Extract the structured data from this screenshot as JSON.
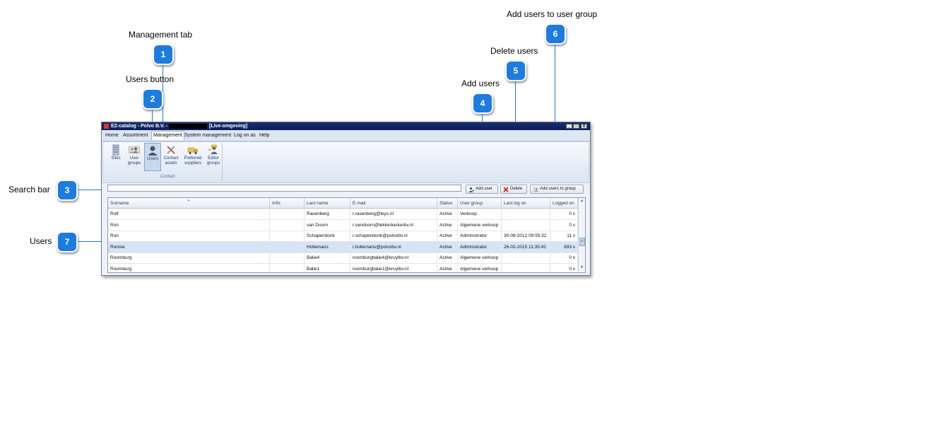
{
  "callouts": [
    {
      "num": "1",
      "label": "Management tab"
    },
    {
      "num": "2",
      "label": "Users button"
    },
    {
      "num": "3",
      "label": "Search bar"
    },
    {
      "num": "4",
      "label": "Add users"
    },
    {
      "num": "5",
      "label": "Delete users"
    },
    {
      "num": "6",
      "label": "Add users to user group"
    },
    {
      "num": "7",
      "label": "Users"
    }
  ],
  "window": {
    "title": "EZ-catalog - Polvo B.V. -",
    "environment": "[Live-omgeving]",
    "controls": {
      "minimize": "_",
      "maximize": "□",
      "close": "X"
    }
  },
  "menu": [
    "Home",
    "Assortment",
    "Management",
    "System management",
    "Log on as",
    "Help"
  ],
  "active_menu": "Management",
  "ribbon": {
    "buttons": [
      {
        "label1": "Sites",
        "label2": "",
        "icon": "building-icon"
      },
      {
        "label1": "User",
        "label2": "groups",
        "icon": "user-group-icon"
      },
      {
        "label1": "Users",
        "label2": "",
        "icon": "user-icon",
        "selected": true
      },
      {
        "label1": "Contact",
        "label2": "assets",
        "icon": "tools-icon"
      },
      {
        "label1": "Preferred",
        "label2": "suppliers",
        "icon": "truck-icon"
      },
      {
        "label1": "Editor",
        "label2": "groups",
        "icon": "editor-group-icon"
      }
    ],
    "group_label": "Contact"
  },
  "search": {
    "value": "",
    "placeholder": ""
  },
  "toolbar": {
    "add_user": "Add user",
    "delete": "Delete",
    "add_to_group": "Add users to group"
  },
  "grid": {
    "columns": [
      "Surname",
      "Infix",
      "Last name",
      "E-mail",
      "Status",
      "User group",
      "Last log on",
      "Logged on"
    ],
    "sort_indicator": "▲",
    "rows": [
      [
        "Rolf",
        "",
        "Rasenberg",
        "r.rasenberg@leys.nl",
        "Active",
        "Verkoop",
        "",
        "0 x"
      ],
      [
        "Ron",
        "",
        "van Doorn",
        "r.vandoorn@lekkerkerkerbv.nl",
        "Active",
        "Algemene verkoop",
        "",
        "0 x"
      ],
      [
        "Ron",
        "",
        "Schapendonk",
        "r.schapendonk@polvobv.nl",
        "Active",
        "Administrator",
        "30-08-2012 09:55:32",
        "11 x"
      ],
      [
        "Ronnie",
        "",
        "Hollemans",
        "r.hollemans@polvobv.nl",
        "Active",
        "Administrator",
        "26-02-2015 11:35:42",
        "693 x"
      ],
      [
        "Roomburg",
        "",
        "Balie4",
        "roomburgbalie4@kruytbv.nl",
        "Active",
        "Algemene verkoop",
        "",
        "0 x"
      ],
      [
        "Roomburg",
        "",
        "Balie1",
        "roomburgbalie1@kruytbv.nl",
        "Active",
        "Algemene verkoop",
        "",
        "0 x"
      ]
    ],
    "selected_row": 3
  },
  "colors": {
    "callout": "#1e7be0",
    "selection": "#d6e4f6",
    "titlebar": "#0b1d5a"
  }
}
